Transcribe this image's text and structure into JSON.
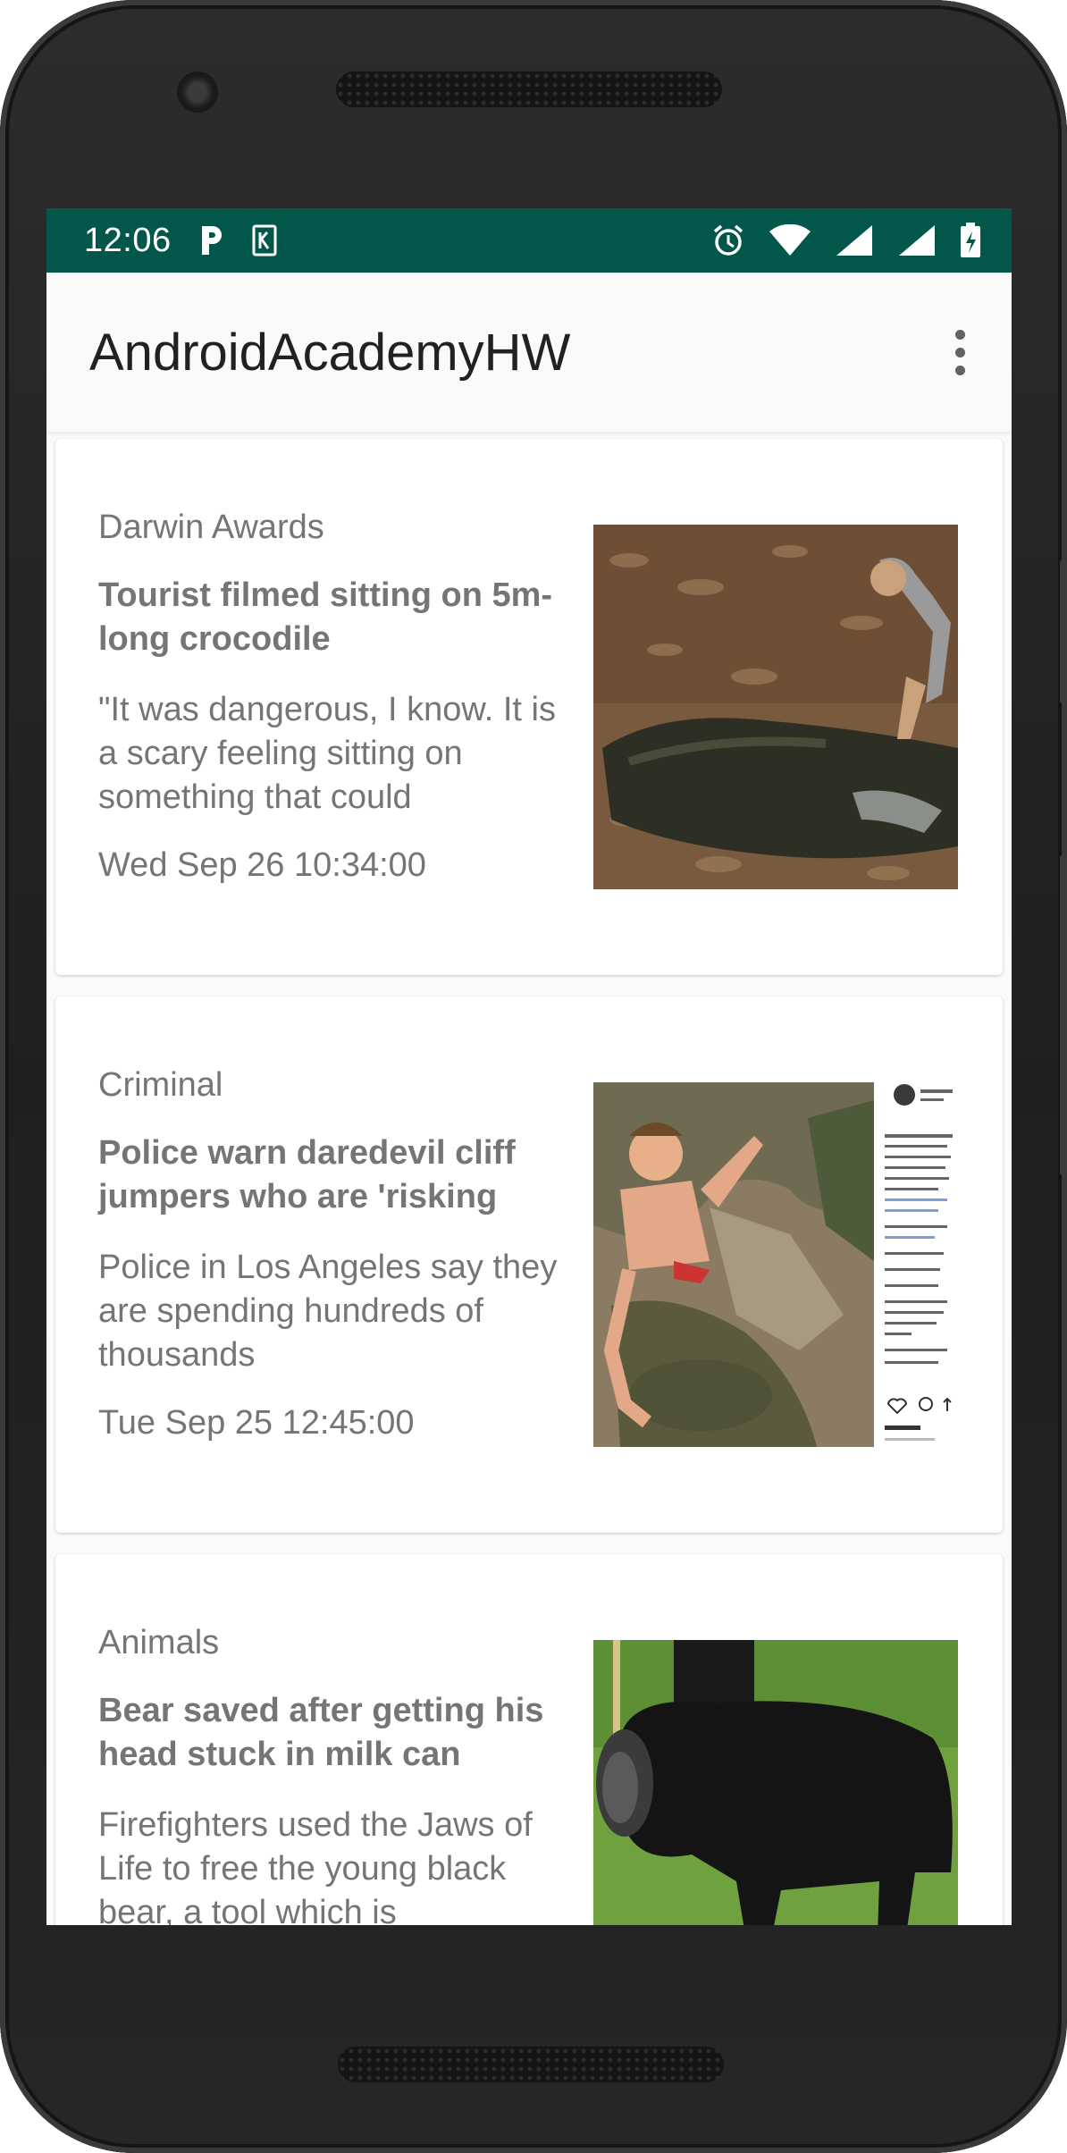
{
  "status_bar": {
    "time": "12:06",
    "left_icons": [
      "parking-notification-icon",
      "keep-notification-icon"
    ],
    "right_icons": [
      "alarm-icon",
      "wifi-icon",
      "cellular-signal-icon",
      "cellular-signal-icon",
      "battery-charging-icon"
    ],
    "background_color": "#03574a"
  },
  "app_bar": {
    "title": "AndroidAcademyHW",
    "menu_icon": "overflow-menu-icon"
  },
  "news": [
    {
      "category": "Darwin Awards",
      "title": "Tourist filmed sitting on 5m-long crocodile",
      "summary": "\"It was dangerous, I know. It is a scary feeling sitting on something that could",
      "date": "Wed Sep 26 10:34:00",
      "image": "crocodile-photo"
    },
    {
      "category": "Criminal",
      "title": "Police warn daredevil cliff jumpers who are 'risking",
      "summary": "Police in Los Angeles say they are spending hundreds of thousands",
      "date": "Tue Sep 25 12:45:00",
      "image": "cliff-jumper-instagram-photo"
    },
    {
      "category": "Animals",
      "title": "Bear saved after getting his head stuck in milk can",
      "summary": "Firefighters used the Jaws of Life to free the young black bear, a tool which is",
      "date": "",
      "image": "bear-photo"
    }
  ]
}
